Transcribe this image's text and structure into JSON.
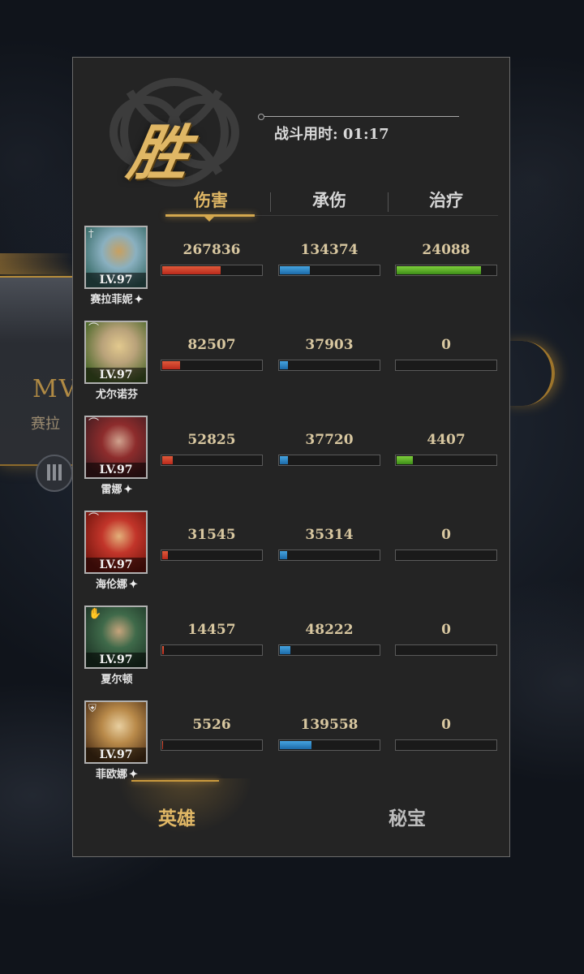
{
  "result": {
    "title": "胜",
    "time_label": "战斗用时: 01:17"
  },
  "background": {
    "mvp_text": "MV",
    "mvp_name": "赛拉"
  },
  "stat_tabs": [
    {
      "label": "伤害",
      "active": true
    },
    {
      "label": "承伤",
      "active": false
    },
    {
      "label": "治疗",
      "active": false
    }
  ],
  "heroes": [
    {
      "name": "赛拉菲妮",
      "level": "LV.97",
      "star": true,
      "class_icon": "sword-icon",
      "damage": "267836",
      "taken": "134374",
      "heal": "24088",
      "damage_frac": 0.59,
      "taken_frac": 0.3,
      "heal_frac": 0.85,
      "colors": [
        "#3a6d6a",
        "#8ab0c0",
        "#c8a060"
      ]
    },
    {
      "name": "尤尔诺芬",
      "level": "LV.97",
      "star": false,
      "class_icon": "bow-icon",
      "damage": "82507",
      "taken": "37903",
      "heal": "0",
      "damage_frac": 0.18,
      "taken_frac": 0.08,
      "heal_frac": 0.0,
      "colors": [
        "#4f6a2c",
        "#b9a27a",
        "#e2c98e"
      ]
    },
    {
      "name": "雷娜",
      "level": "LV.97",
      "star": true,
      "class_icon": "bow-icon",
      "damage": "52825",
      "taken": "37720",
      "heal": "4407",
      "damage_frac": 0.11,
      "taken_frac": 0.08,
      "heal_frac": 0.16,
      "colors": [
        "#4b1e22",
        "#8d2c2c",
        "#d0a28e"
      ]
    },
    {
      "name": "海伦娜",
      "level": "LV.97",
      "star": true,
      "class_icon": "bow-icon",
      "damage": "31545",
      "taken": "35314",
      "heal": "0",
      "damage_frac": 0.06,
      "taken_frac": 0.07,
      "heal_frac": 0.0,
      "colors": [
        "#7a1810",
        "#c2352a",
        "#e3b07a"
      ]
    },
    {
      "name": "夏尔顿",
      "level": "LV.97",
      "star": false,
      "class_icon": "hand-icon",
      "damage": "14457",
      "taken": "48222",
      "heal": "0",
      "damage_frac": 0.02,
      "taken_frac": 0.11,
      "heal_frac": 0.0,
      "colors": [
        "#213a2a",
        "#3f6a4a",
        "#c6a47c"
      ]
    },
    {
      "name": "菲欧娜",
      "level": "LV.97",
      "star": true,
      "class_icon": "shield-icon",
      "damage": "5526",
      "taken": "139558",
      "heal": "0",
      "damage_frac": 0.01,
      "taken_frac": 0.32,
      "heal_frac": 0.0,
      "colors": [
        "#5a3a1c",
        "#b98a4a",
        "#e8cfa0"
      ]
    }
  ],
  "bottom_tabs": [
    {
      "label": "英雄",
      "active": true
    },
    {
      "label": "秘宝",
      "active": false
    }
  ]
}
